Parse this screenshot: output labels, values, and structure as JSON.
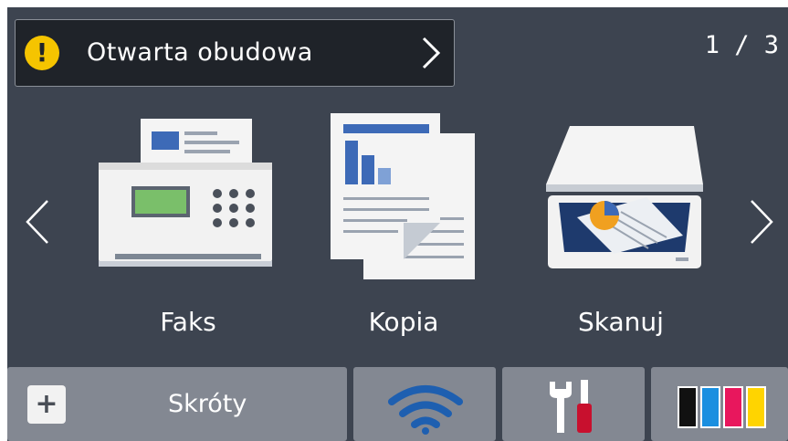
{
  "status": {
    "message": "Otwarta obudowa",
    "warning_icon": "warning-icon",
    "warning_glyph": "!",
    "accent_color": "#f5c400"
  },
  "pager": {
    "indicator": "1 / 3"
  },
  "apps": [
    {
      "label": "Faks",
      "icon": "fax-icon"
    },
    {
      "label": "Kopia",
      "icon": "copy-icon"
    },
    {
      "label": "Skanuj",
      "icon": "scanner-icon"
    }
  ],
  "dock": {
    "shortcuts_label": "Skróty",
    "plus_glyph": "+",
    "wifi_icon": "wifi-icon",
    "tools_icon": "tools-icon",
    "ink_icon": "ink-icon",
    "ink_colors": [
      "#111111",
      "#1a8fe0",
      "#e8175d",
      "#ffd400"
    ]
  },
  "colors": {
    "background": "#3d4450",
    "status_bar": "#1f2329",
    "dock_button": "#838892",
    "wifi_blue": "#1e5fb0",
    "tool_red": "#c8102e"
  }
}
